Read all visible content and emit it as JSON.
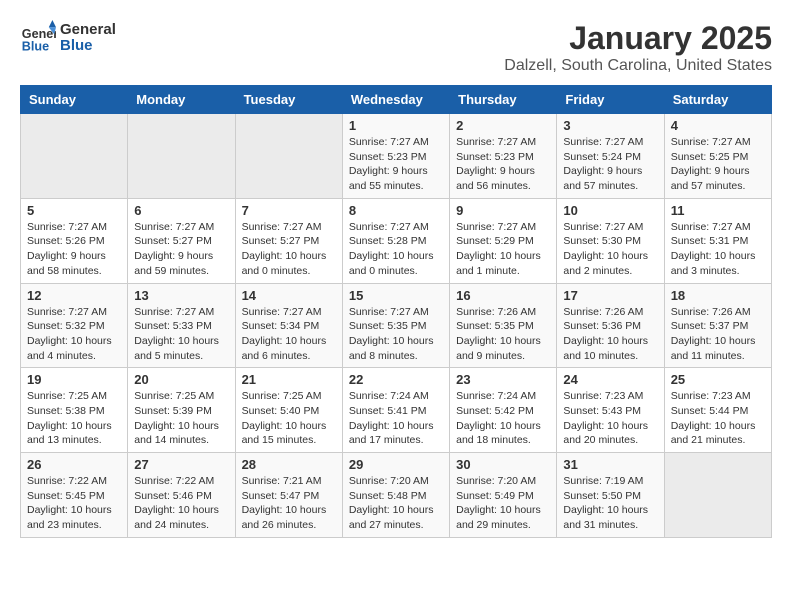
{
  "header": {
    "logo_general": "General",
    "logo_blue": "Blue",
    "title": "January 2025",
    "subtitle": "Dalzell, South Carolina, United States"
  },
  "weekdays": [
    "Sunday",
    "Monday",
    "Tuesday",
    "Wednesday",
    "Thursday",
    "Friday",
    "Saturday"
  ],
  "weeks": [
    [
      {
        "day": "",
        "info": ""
      },
      {
        "day": "",
        "info": ""
      },
      {
        "day": "",
        "info": ""
      },
      {
        "day": "1",
        "info": "Sunrise: 7:27 AM\nSunset: 5:23 PM\nDaylight: 9 hours\nand 55 minutes."
      },
      {
        "day": "2",
        "info": "Sunrise: 7:27 AM\nSunset: 5:23 PM\nDaylight: 9 hours\nand 56 minutes."
      },
      {
        "day": "3",
        "info": "Sunrise: 7:27 AM\nSunset: 5:24 PM\nDaylight: 9 hours\nand 57 minutes."
      },
      {
        "day": "4",
        "info": "Sunrise: 7:27 AM\nSunset: 5:25 PM\nDaylight: 9 hours\nand 57 minutes."
      }
    ],
    [
      {
        "day": "5",
        "info": "Sunrise: 7:27 AM\nSunset: 5:26 PM\nDaylight: 9 hours\nand 58 minutes."
      },
      {
        "day": "6",
        "info": "Sunrise: 7:27 AM\nSunset: 5:27 PM\nDaylight: 9 hours\nand 59 minutes."
      },
      {
        "day": "7",
        "info": "Sunrise: 7:27 AM\nSunset: 5:27 PM\nDaylight: 10 hours\nand 0 minutes."
      },
      {
        "day": "8",
        "info": "Sunrise: 7:27 AM\nSunset: 5:28 PM\nDaylight: 10 hours\nand 0 minutes."
      },
      {
        "day": "9",
        "info": "Sunrise: 7:27 AM\nSunset: 5:29 PM\nDaylight: 10 hours\nand 1 minute."
      },
      {
        "day": "10",
        "info": "Sunrise: 7:27 AM\nSunset: 5:30 PM\nDaylight: 10 hours\nand 2 minutes."
      },
      {
        "day": "11",
        "info": "Sunrise: 7:27 AM\nSunset: 5:31 PM\nDaylight: 10 hours\nand 3 minutes."
      }
    ],
    [
      {
        "day": "12",
        "info": "Sunrise: 7:27 AM\nSunset: 5:32 PM\nDaylight: 10 hours\nand 4 minutes."
      },
      {
        "day": "13",
        "info": "Sunrise: 7:27 AM\nSunset: 5:33 PM\nDaylight: 10 hours\nand 5 minutes."
      },
      {
        "day": "14",
        "info": "Sunrise: 7:27 AM\nSunset: 5:34 PM\nDaylight: 10 hours\nand 6 minutes."
      },
      {
        "day": "15",
        "info": "Sunrise: 7:27 AM\nSunset: 5:35 PM\nDaylight: 10 hours\nand 8 minutes."
      },
      {
        "day": "16",
        "info": "Sunrise: 7:26 AM\nSunset: 5:35 PM\nDaylight: 10 hours\nand 9 minutes."
      },
      {
        "day": "17",
        "info": "Sunrise: 7:26 AM\nSunset: 5:36 PM\nDaylight: 10 hours\nand 10 minutes."
      },
      {
        "day": "18",
        "info": "Sunrise: 7:26 AM\nSunset: 5:37 PM\nDaylight: 10 hours\nand 11 minutes."
      }
    ],
    [
      {
        "day": "19",
        "info": "Sunrise: 7:25 AM\nSunset: 5:38 PM\nDaylight: 10 hours\nand 13 minutes."
      },
      {
        "day": "20",
        "info": "Sunrise: 7:25 AM\nSunset: 5:39 PM\nDaylight: 10 hours\nand 14 minutes."
      },
      {
        "day": "21",
        "info": "Sunrise: 7:25 AM\nSunset: 5:40 PM\nDaylight: 10 hours\nand 15 minutes."
      },
      {
        "day": "22",
        "info": "Sunrise: 7:24 AM\nSunset: 5:41 PM\nDaylight: 10 hours\nand 17 minutes."
      },
      {
        "day": "23",
        "info": "Sunrise: 7:24 AM\nSunset: 5:42 PM\nDaylight: 10 hours\nand 18 minutes."
      },
      {
        "day": "24",
        "info": "Sunrise: 7:23 AM\nSunset: 5:43 PM\nDaylight: 10 hours\nand 20 minutes."
      },
      {
        "day": "25",
        "info": "Sunrise: 7:23 AM\nSunset: 5:44 PM\nDaylight: 10 hours\nand 21 minutes."
      }
    ],
    [
      {
        "day": "26",
        "info": "Sunrise: 7:22 AM\nSunset: 5:45 PM\nDaylight: 10 hours\nand 23 minutes."
      },
      {
        "day": "27",
        "info": "Sunrise: 7:22 AM\nSunset: 5:46 PM\nDaylight: 10 hours\nand 24 minutes."
      },
      {
        "day": "28",
        "info": "Sunrise: 7:21 AM\nSunset: 5:47 PM\nDaylight: 10 hours\nand 26 minutes."
      },
      {
        "day": "29",
        "info": "Sunrise: 7:20 AM\nSunset: 5:48 PM\nDaylight: 10 hours\nand 27 minutes."
      },
      {
        "day": "30",
        "info": "Sunrise: 7:20 AM\nSunset: 5:49 PM\nDaylight: 10 hours\nand 29 minutes."
      },
      {
        "day": "31",
        "info": "Sunrise: 7:19 AM\nSunset: 5:50 PM\nDaylight: 10 hours\nand 31 minutes."
      },
      {
        "day": "",
        "info": ""
      }
    ]
  ]
}
